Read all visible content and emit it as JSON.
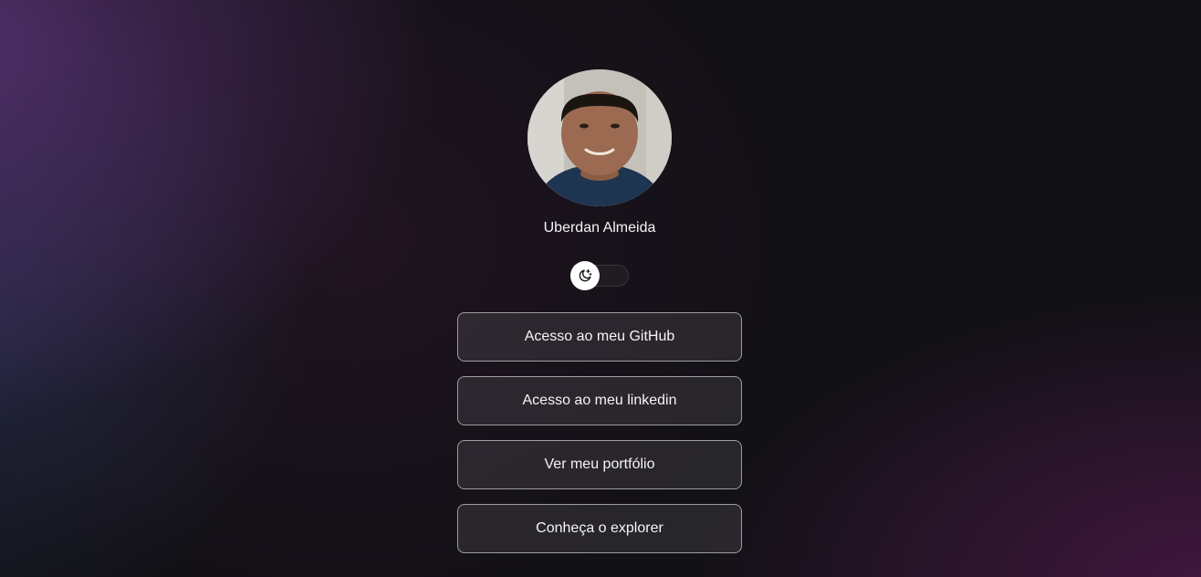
{
  "profile": {
    "name": "Uberdan Almeida",
    "avatar_icon": "profile-photo"
  },
  "theme_switch": {
    "state": "dark",
    "icon": "moon-stars-icon"
  },
  "links": [
    {
      "label": "Acesso ao meu GitHub"
    },
    {
      "label": "Acesso ao meu linkedin"
    },
    {
      "label": "Ver meu portfólio"
    },
    {
      "label": "Conheça o explorer"
    }
  ],
  "colors": {
    "background": "#121116",
    "accent_purple": "#623680",
    "button_border": "#8c8a90",
    "text": "#f3f1f6"
  }
}
